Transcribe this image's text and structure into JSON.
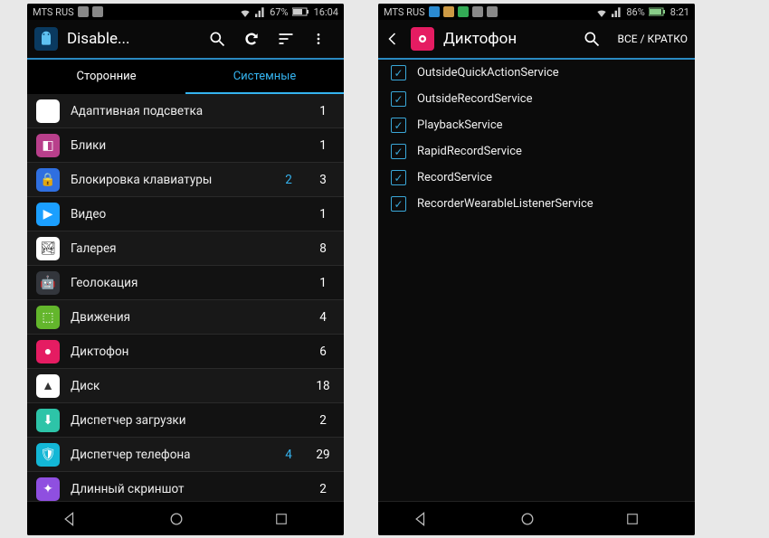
{
  "phone1": {
    "status": {
      "carrier": "MTS RUS",
      "battery": "67%",
      "time": "16:04"
    },
    "title": "Disable...",
    "tabs": [
      "Сторонние",
      "Системные"
    ],
    "active_tab": 1,
    "rows": [
      {
        "name": "Адаптивная подсветка",
        "blue": "",
        "count": "1",
        "color": "#fff",
        "emoji": "◎",
        "text_dark": false
      },
      {
        "name": "Блики",
        "blue": "",
        "count": "1",
        "color": "#b83f8b",
        "emoji": "◧",
        "text_dark": false
      },
      {
        "name": "Блокировка клавиатуры",
        "blue": "2",
        "count": "3",
        "color": "#2f6fe0",
        "emoji": "🔒",
        "text_dark": false
      },
      {
        "name": "Видео",
        "blue": "",
        "count": "1",
        "color": "#1b9fff",
        "emoji": "▶",
        "text_dark": false
      },
      {
        "name": "Галерея",
        "blue": "",
        "count": "8",
        "color": "#ffffff",
        "emoji": "🏞",
        "text_dark": true
      },
      {
        "name": "Геолокация",
        "blue": "",
        "count": "1",
        "color": "#33363c",
        "emoji": "🤖",
        "text_dark": false
      },
      {
        "name": "Движения",
        "blue": "",
        "count": "4",
        "color": "#63b62c",
        "emoji": "⬚",
        "text_dark": false
      },
      {
        "name": "Диктофон",
        "blue": "",
        "count": "6",
        "color": "#e51c62",
        "emoji": "●",
        "text_dark": false
      },
      {
        "name": "Диск",
        "blue": "",
        "count": "18",
        "color": "#ffffff",
        "emoji": "▲",
        "text_dark": true
      },
      {
        "name": "Диспетчер загрузки",
        "blue": "",
        "count": "2",
        "color": "#2dc4a8",
        "emoji": "⬇",
        "text_dark": false
      },
      {
        "name": "Диспетчер телефона",
        "blue": "4",
        "count": "29",
        "color": "#13b7d6",
        "emoji": "🛡",
        "text_dark": false
      },
      {
        "name": "Длинный скриншот",
        "blue": "",
        "count": "2",
        "color": "#8f4fe0",
        "emoji": "✦",
        "text_dark": false
      }
    ]
  },
  "phone2": {
    "status": {
      "carrier": "MTS RUS",
      "battery": "86%",
      "time": "8:21"
    },
    "title": "Диктофон",
    "toggle_label": "ВСЕ / КРАТКО",
    "services": [
      "OutsideQuickActionService",
      "OutsideRecordService",
      "PlaybackService",
      "RapidRecordService",
      "RecordService",
      "RecorderWearableListenerService"
    ]
  }
}
